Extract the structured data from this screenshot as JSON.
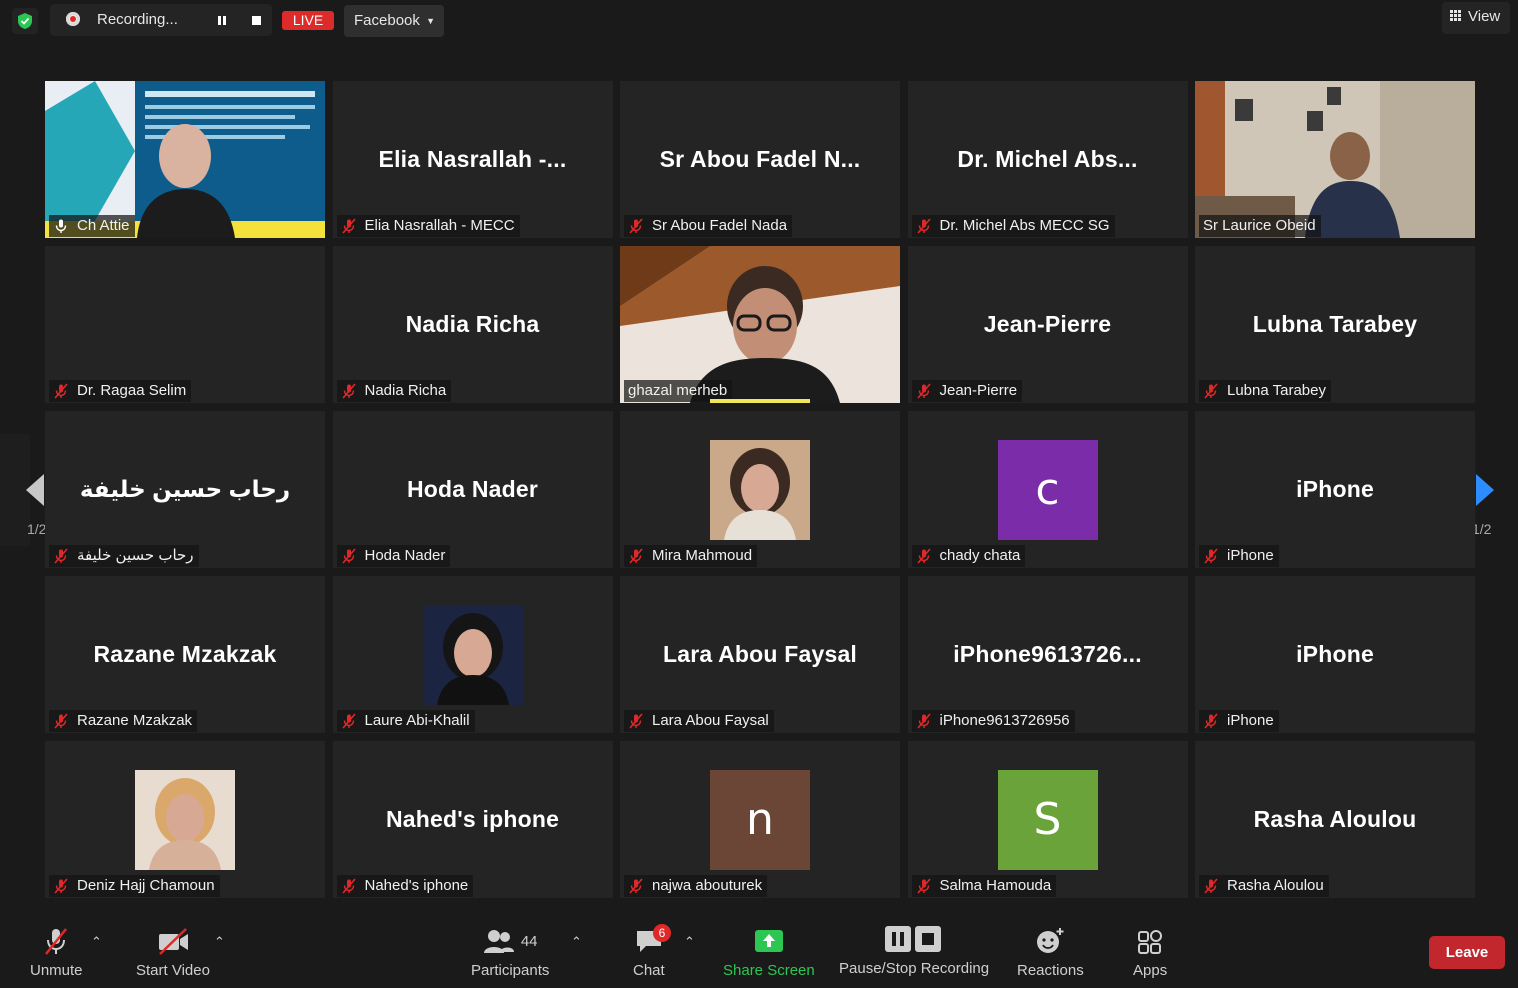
{
  "topbar": {
    "recording_label": "Recording...",
    "live_label": "LIVE",
    "stream_target": "Facebook",
    "view_label": "View"
  },
  "tiles": [
    {
      "label": "Ch Attie",
      "type": "video"
    },
    {
      "big": "Elia  Nasrallah  -...",
      "label": "Elia Nasrallah - MECC"
    },
    {
      "big": "Sr  Abou  Fadel  N...",
      "label": "Sr Abou Fadel Nada"
    },
    {
      "big": "Dr.  Michel  Abs...",
      "label": "Dr. Michel Abs MECC SG"
    },
    {
      "label": "Sr Laurice Obeid",
      "type": "video"
    },
    {
      "big": "",
      "label": "Dr. Ragaa Selim"
    },
    {
      "big": "Nadia Richa",
      "label": "Nadia Richa"
    },
    {
      "label": "ghazal merheb",
      "type": "video"
    },
    {
      "big": "Jean-Pierre",
      "label": "Jean-Pierre"
    },
    {
      "big": "Lubna Tarabey",
      "label": "Lubna Tarabey"
    },
    {
      "big": "رحاب حسين خليفة",
      "label": "رحاب حسين خليفة"
    },
    {
      "big": "Hoda Nader",
      "label": "Hoda Nader"
    },
    {
      "label": "Mira Mahmoud",
      "type": "photo"
    },
    {
      "letter": "c",
      "letter_color": "#7b2ca8",
      "label": "chady chata"
    },
    {
      "big": "iPhone",
      "label": "iPhone"
    },
    {
      "big": "Razane Mzakzak",
      "label": "Razane Mzakzak"
    },
    {
      "label": "Laure Abi-Khalil",
      "type": "photo"
    },
    {
      "big": "Lara Abou Faysal",
      "label": "Lara Abou Faysal"
    },
    {
      "big": "iPhone9613726...",
      "label": "iPhone9613726956"
    },
    {
      "big": "iPhone",
      "label": "iPhone"
    },
    {
      "label": "Deniz Hajj Chamoun",
      "type": "photo"
    },
    {
      "big": "Nahed's iphone",
      "label": "Nahed's iphone"
    },
    {
      "letter": "n",
      "letter_color": "#6b4536",
      "label": "najwa abouturek"
    },
    {
      "letter": "S",
      "letter_color": "#6aa33a",
      "label": "Salma Hamouda"
    },
    {
      "big": "Rasha Aloulou",
      "label": "Rasha Aloulou"
    }
  ],
  "pager": {
    "left_count": "1/2",
    "right_count": "1/2"
  },
  "toolbar": {
    "unmute": "Unmute",
    "start_video": "Start Video",
    "participants": "Participants",
    "participant_count": "44",
    "chat": "Chat",
    "chat_badge": "6",
    "share_screen": "Share Screen",
    "pause_stop": "Pause/Stop Recording",
    "reactions": "Reactions",
    "apps": "Apps",
    "leave": "Leave"
  },
  "colors": {
    "active_speaker": "#d4e157",
    "share_green": "#2dc653",
    "leave_red": "#c1272d"
  }
}
